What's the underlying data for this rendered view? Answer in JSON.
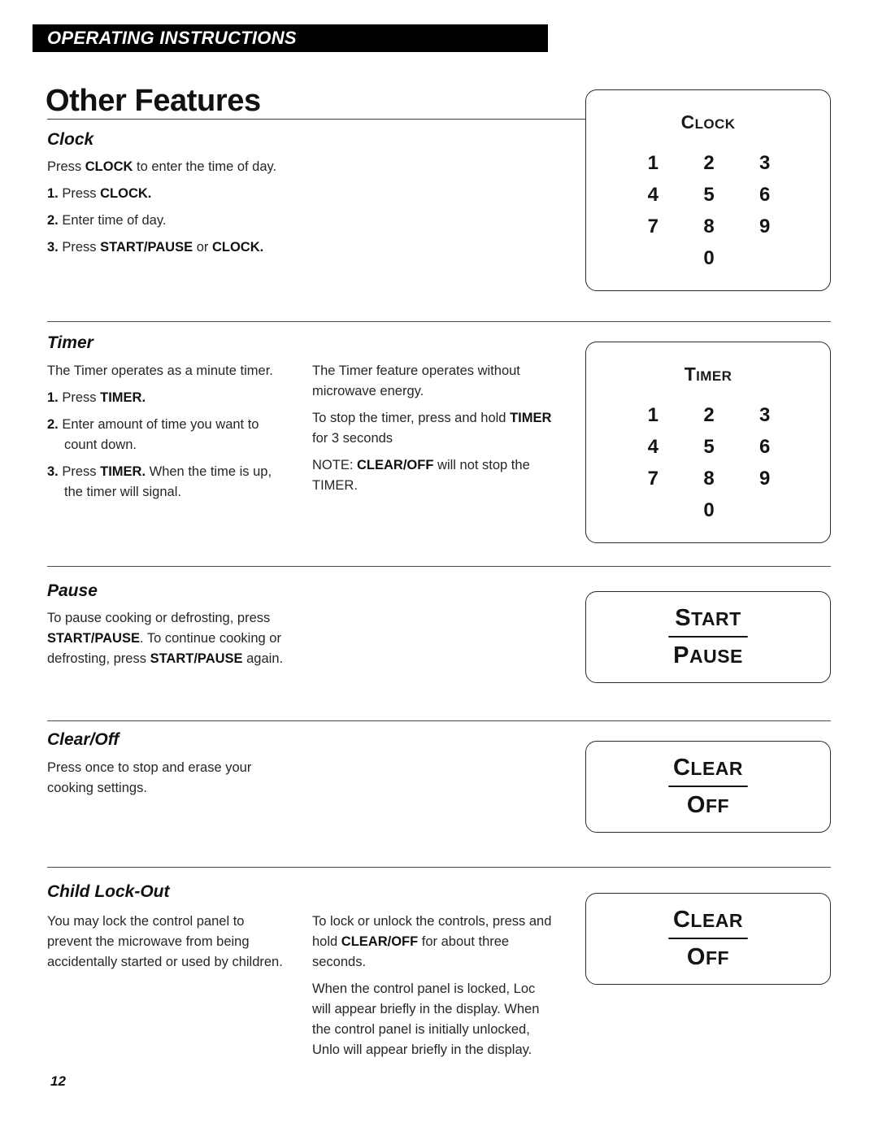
{
  "header": {
    "banner_label": "OPERATING INSTRUCTIONS",
    "page_title": "Other Features"
  },
  "sections": {
    "clock": {
      "heading": "Clock",
      "intro_pre": "Press ",
      "intro_bold": "CLOCK",
      "intro_post": " to enter the time of day.",
      "steps": [
        {
          "num": "1.",
          "pre": " Press ",
          "bold": "CLOCK.",
          "post": ""
        },
        {
          "num": "2.",
          "pre": " Enter time of day.",
          "bold": "",
          "post": ""
        },
        {
          "num": "3.",
          "pre": " Press ",
          "bold": "START/PAUSE",
          "post": " or ",
          "bold2": "CLOCK."
        }
      ]
    },
    "timer": {
      "heading": "Timer",
      "intro": "The Timer operates as a minute timer.",
      "steps": [
        {
          "num": "1.",
          "pre": " Press ",
          "bold": "TIMER.",
          "post": ""
        },
        {
          "num": "2.",
          "pre": " Enter amount of time you want to count down.",
          "bold": "",
          "post": ""
        },
        {
          "num": "3.",
          "pre": " Press ",
          "bold": "TIMER.",
          "post": " When the time is up, the timer will signal."
        }
      ],
      "col_b": {
        "p1": "The Timer feature operates without microwave energy.",
        "p2_pre": "To stop the timer, press and hold ",
        "p2_bold": "TIMER",
        "p2_post": " for 3 seconds",
        "p3_pre": "NOTE: ",
        "p3_bold": "CLEAR/OFF",
        "p3_post": " will not stop the TIMER."
      }
    },
    "pause": {
      "heading": "Pause",
      "body_pre": "To pause cooking or defrosting, press ",
      "body_bold1": "START/PAUSE",
      "body_mid": ". To continue cooking or defrosting, press ",
      "body_bold2": "START/PAUSE",
      "body_post": " again."
    },
    "clear_off": {
      "heading": "Clear/Off",
      "body": "Press once to stop and erase your cooking settings."
    },
    "child_lock_out": {
      "heading": "Child Lock-Out",
      "col_a": "You may lock the control panel to prevent the microwave from being accidentally started or used by children.",
      "col_b": {
        "p1_pre": "To lock or unlock the controls, press and hold ",
        "p1_bold": "CLEAR/OFF",
        "p1_post": " for about three seconds.",
        "p2": "When the control panel is locked, Loc will appear briefly in the display. When the control panel is initially unlocked, Unlo will appear briefly in the display."
      }
    }
  },
  "panels": {
    "clock_keypad": {
      "caption_first": "C",
      "caption_rest": "LOCK",
      "keys": [
        "1",
        "2",
        "3",
        "4",
        "5",
        "6",
        "7",
        "8",
        "9"
      ],
      "zero_key": "0"
    },
    "timer_keypad": {
      "caption_first": "T",
      "caption_rest": "IMER",
      "keys": [
        "1",
        "2",
        "3",
        "4",
        "5",
        "6",
        "7",
        "8",
        "9"
      ],
      "zero_key": "0"
    },
    "start_pause_button": {
      "line1_first": "S",
      "line1_rest": "TART",
      "line2_first": "P",
      "line2_rest": "AUSE"
    },
    "clear_off_button": {
      "line1_first": "C",
      "line1_rest": "LEAR",
      "line2_first": "O",
      "line2_rest": "FF"
    },
    "clear_off_button_2": {
      "line1_first": "C",
      "line1_rest": "LEAR",
      "line2_first": "O",
      "line2_rest": "FF"
    }
  },
  "footer": {
    "page_number": "12"
  },
  "colors": {
    "banner_bg": "#000000",
    "banner_text": "#ffffff",
    "body_text": "#262626",
    "rule": "#4a4a4a"
  }
}
